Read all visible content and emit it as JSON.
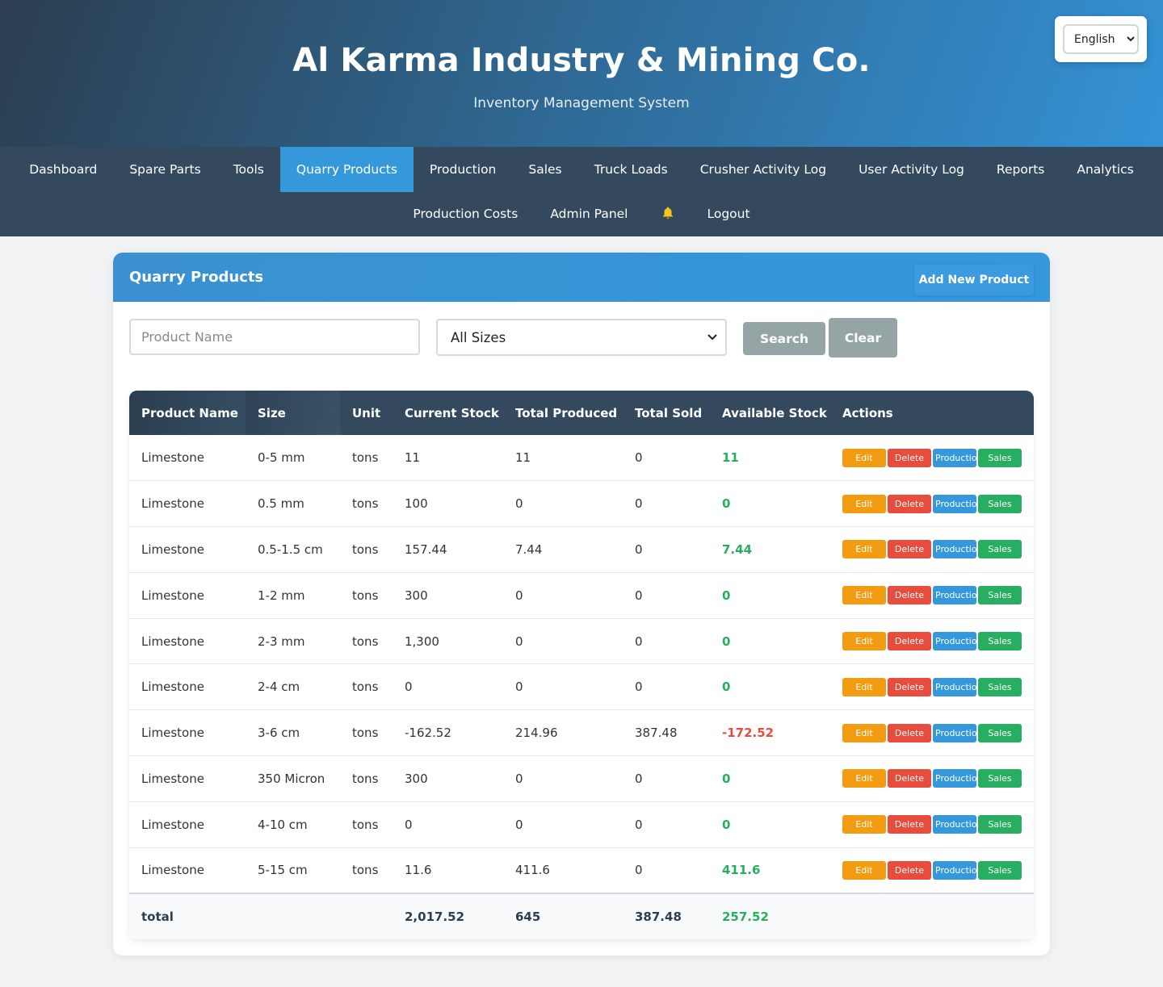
{
  "header": {
    "title": "Al Karma Industry & Mining Co.",
    "subtitle": "Inventory Management System",
    "language": "English"
  },
  "nav": {
    "row1": [
      {
        "label": "Dashboard",
        "active": false
      },
      {
        "label": "Spare Parts",
        "active": false
      },
      {
        "label": "Tools",
        "active": false
      },
      {
        "label": "Quarry Products",
        "active": true
      },
      {
        "label": "Production",
        "active": false
      },
      {
        "label": "Sales",
        "active": false
      },
      {
        "label": "Truck Loads",
        "active": false
      },
      {
        "label": "Crusher Activity Log",
        "active": false
      },
      {
        "label": "User Activity Log",
        "active": false
      },
      {
        "label": "Reports",
        "active": false
      },
      {
        "label": "Analytics",
        "active": false
      }
    ],
    "row2": [
      {
        "label": "Production Costs"
      },
      {
        "label": "Admin Panel"
      },
      {
        "label": "",
        "icon": "bell-icon"
      },
      {
        "label": "Logout"
      }
    ]
  },
  "card": {
    "title": "Quarry Products",
    "add_button": "Add New Product"
  },
  "filters": {
    "name_placeholder": "Product Name",
    "size_selected": "All Sizes",
    "search_label": "Search",
    "clear_label": "Clear"
  },
  "table": {
    "columns": [
      "Product Name",
      "Size",
      "Unit",
      "Current Stock",
      "Total Produced",
      "Total Sold",
      "Available Stock",
      "Actions"
    ],
    "action_labels": {
      "edit": "Edit",
      "delete": "Delete",
      "production": "Production",
      "sales": "Sales"
    },
    "rows": [
      {
        "name": "Limestone",
        "size": "0-5 mm",
        "unit": "tons",
        "current": "11",
        "produced": "11",
        "sold": "0",
        "available": "11",
        "negative": false
      },
      {
        "name": "Limestone",
        "size": "0.5 mm",
        "unit": "tons",
        "current": "100",
        "produced": "0",
        "sold": "0",
        "available": "0",
        "negative": false
      },
      {
        "name": "Limestone",
        "size": "0.5-1.5 cm",
        "unit": "tons",
        "current": "157.44",
        "produced": "7.44",
        "sold": "0",
        "available": "7.44",
        "negative": false
      },
      {
        "name": "Limestone",
        "size": "1-2 mm",
        "unit": "tons",
        "current": "300",
        "produced": "0",
        "sold": "0",
        "available": "0",
        "negative": false
      },
      {
        "name": "Limestone",
        "size": "2-3 mm",
        "unit": "tons",
        "current": "1,300",
        "produced": "0",
        "sold": "0",
        "available": "0",
        "negative": false
      },
      {
        "name": "Limestone",
        "size": "2-4 cm",
        "unit": "tons",
        "current": "0",
        "produced": "0",
        "sold": "0",
        "available": "0",
        "negative": false
      },
      {
        "name": "Limestone",
        "size": "3-6 cm",
        "unit": "tons",
        "current": "-162.52",
        "produced": "214.96",
        "sold": "387.48",
        "available": "-172.52",
        "negative": true
      },
      {
        "name": "Limestone",
        "size": "350 Micron",
        "unit": "tons",
        "current": "300",
        "produced": "0",
        "sold": "0",
        "available": "0",
        "negative": false
      },
      {
        "name": "Limestone",
        "size": "4-10 cm",
        "unit": "tons",
        "current": "0",
        "produced": "0",
        "sold": "0",
        "available": "0",
        "negative": false
      },
      {
        "name": "Limestone",
        "size": "5-15 cm",
        "unit": "tons",
        "current": "11.6",
        "produced": "411.6",
        "sold": "0",
        "available": "411.6",
        "negative": false
      }
    ],
    "total": {
      "label": "total",
      "current": "2,017.52",
      "produced": "645",
      "sold": "387.48",
      "available": "257.52"
    }
  },
  "colors": {
    "nav_bg": "#34495e",
    "accent": "#3498db",
    "positive": "#27ae60",
    "negative": "#e74c3c",
    "edit": "#f39c12",
    "delete": "#e74c3c",
    "production": "#3498db",
    "sales": "#27ae60"
  }
}
